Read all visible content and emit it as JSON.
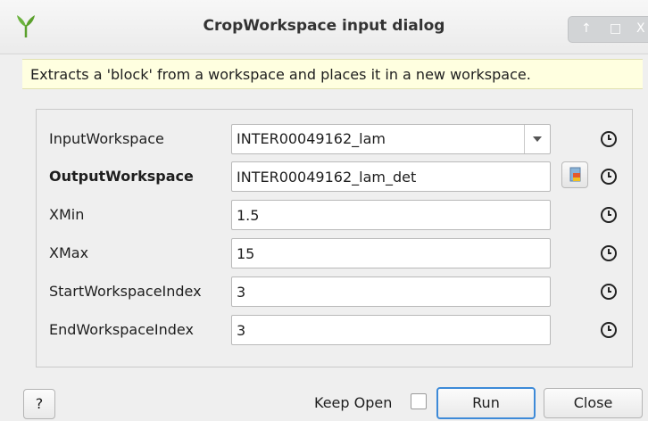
{
  "window": {
    "title": "CropWorkspace input dialog",
    "icon": "mantid-leaf-icon",
    "controls": [
      "↑",
      "□",
      "X"
    ]
  },
  "description": "Extracts a 'block' from a workspace and places it in a new workspace.",
  "properties": [
    {
      "label": "InputWorkspace",
      "value": "INTER00049162_lam",
      "type": "combo",
      "bold": false
    },
    {
      "label": "OutputWorkspace",
      "value": "INTER00049162_lam_det",
      "type": "text",
      "bold": true
    },
    {
      "label": "XMin",
      "value": "1.5",
      "type": "text",
      "bold": false
    },
    {
      "label": "XMax",
      "value": "15",
      "type": "text",
      "bold": false
    },
    {
      "label": "StartWorkspaceIndex",
      "value": "3",
      "type": "text",
      "bold": false
    },
    {
      "label": "EndWorkspaceIndex",
      "value": "3",
      "type": "text",
      "bold": false
    }
  ],
  "footer": {
    "help_label": "?",
    "keep_open_label": "Keep Open",
    "keep_open_checked": false,
    "run_label": "Run",
    "close_label": "Close"
  },
  "colors": {
    "description_bg": "#ffffe0",
    "accent_border": "#3d8ad8",
    "leaf_green": "#5aa02c"
  }
}
